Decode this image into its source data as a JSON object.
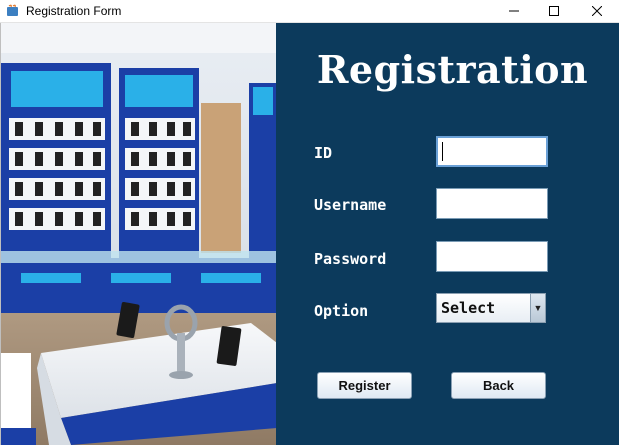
{
  "window": {
    "title": "Registration Form",
    "icons": {
      "app": "java-app-icon",
      "minimize": "minimize-icon",
      "maximize": "maximize-icon",
      "close": "close-icon"
    }
  },
  "form": {
    "heading": "Registration",
    "id_label": "ID",
    "id_value": "",
    "username_label": "Username",
    "username_value": "",
    "password_label": "Password",
    "password_value": "",
    "option_label": "Option",
    "option_selected": "Select",
    "register_label": "Register",
    "back_label": "Back"
  },
  "colors": {
    "panel_bg": "#0c3a5c",
    "text": "#ffffff"
  }
}
